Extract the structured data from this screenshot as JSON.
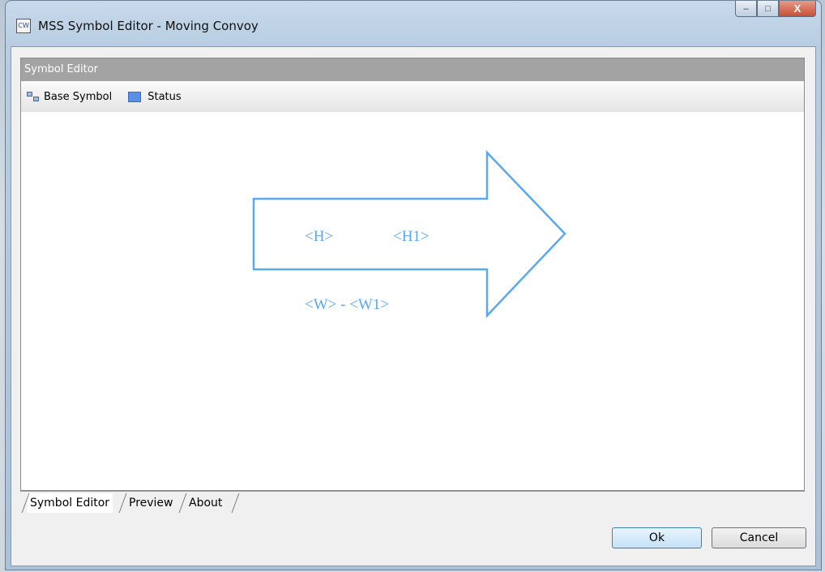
{
  "window": {
    "title": "MSS Symbol Editor - Moving Convoy",
    "icon": "app-icon",
    "icon_text": "CW",
    "controls": {
      "minimize": "–",
      "maximize": "□",
      "close": "X"
    }
  },
  "panel": {
    "header": "Symbol Editor"
  },
  "toolbar": {
    "base_symbol_label": "Base Symbol",
    "status_label": "Status",
    "status_color": "#5b8ee6"
  },
  "symbol": {
    "shape": "arrow-right",
    "stroke_color": "#5aa8f0",
    "label_h": "<H>",
    "label_h1": "<H1>",
    "label_w": "<W> - <W1>"
  },
  "tabs": [
    {
      "label": "Symbol Editor",
      "active": true
    },
    {
      "label": "Preview",
      "active": false
    },
    {
      "label": "About",
      "active": false
    }
  ],
  "buttons": {
    "ok": "Ok",
    "cancel": "Cancel"
  }
}
